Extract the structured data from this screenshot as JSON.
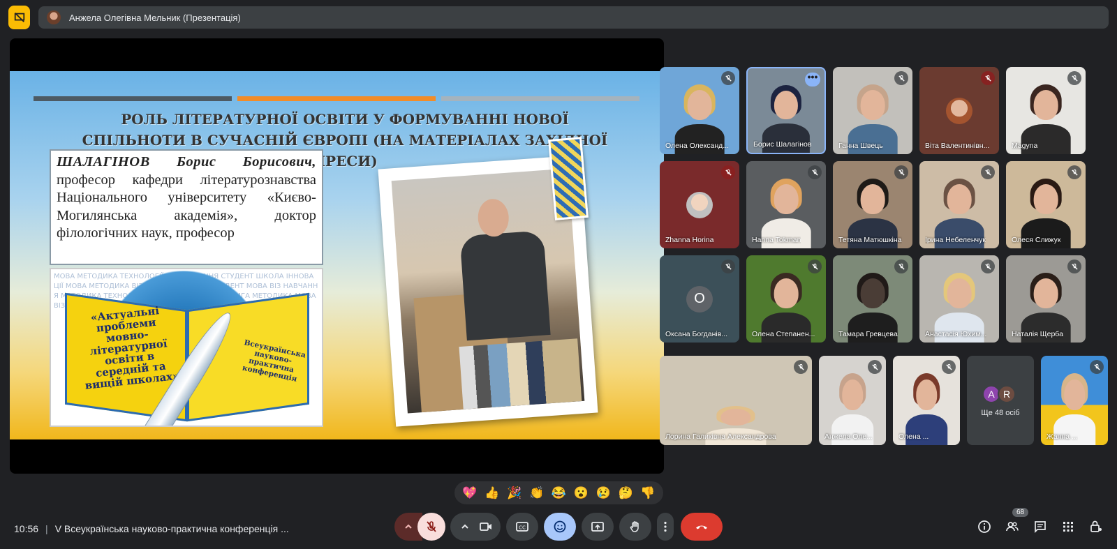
{
  "header": {
    "presenter_label": "Анжела Олегівна Мельник (Презентація)"
  },
  "slide": {
    "title": "РОЛЬ ЛІТЕРАТУРНОЇ ОСВІТИ У ФОРМУВАННІ НОВОЇ СПІЛЬНОТИ В СУЧАСНІЙ ЄВРОПІ (НА МАТЕРІАЛАХ ЗАХІДНОЇ ПРЕСИ)",
    "speaker_name": "ШАЛАГІНОВ Борис Борисович,",
    "speaker_bio": "професор кафедри літературознавства Національного університету «Києво-Могилянська академія», доктор філологічних наук, професор",
    "book_title": "«Актуальні проблеми мовно-літературної освіти в середній та вищій школах»",
    "book_subtitle": "Всеукраїнська науково-практична конференція",
    "wordcloud": "МОВА МЕТОДИКА ТЕХНОЛОГІЇ ВІЗ НАВЧАННЯ СТУДЕНТ ШКОЛА ІННОВАЦІЇ МОВА МЕТОДИКА ВІЗ ІННОВАЦІЇ КНИГА СТУДЕНТ МОВА ВІЗ НАВЧАННЯ МЕТОДИКА ТЕХНОЛОГІЇ ІННОВАЦІЇ МОВА ВІЗ КНИГА МЕТОДИКА МОВА ВІЗ"
  },
  "colors": {
    "bar_1": "#4d5a63",
    "bar_2": "#f28c28",
    "bar_3": "#a5b3bd",
    "accent_blue": "#8ab4f8",
    "hangup_red": "#dc3b2f",
    "presenting_yellow": "#fbbc04"
  },
  "participants": [
    {
      "name": "Олена Олександ...",
      "muted": true
    },
    {
      "name": "Борис Шалагінов",
      "muted": false,
      "more_options": true
    },
    {
      "name": "Ганна Швець",
      "muted": true
    },
    {
      "name": "Віта Валентинівн...",
      "muted": true
    },
    {
      "name": "Magyna",
      "muted": true
    },
    {
      "name": "Zhanna Horina",
      "muted": true
    },
    {
      "name": "Hanna Tokman",
      "muted": true
    },
    {
      "name": "Тетяна Матюшкіна",
      "muted": true
    },
    {
      "name": "Ірина Небеленчук",
      "muted": true
    },
    {
      "name": "Олеся Слижук",
      "muted": true
    },
    {
      "name": "Оксана Богданів...",
      "muted": true,
      "initial": "О"
    },
    {
      "name": "Олена Степанен...",
      "muted": true
    },
    {
      "name": "Тамара Гревцева",
      "muted": true
    },
    {
      "name": "Анастасія Юхим...",
      "muted": true
    },
    {
      "name": "Наталія Щерба",
      "muted": true
    },
    {
      "name": "Лорина Галиківна Александрова",
      "muted": true
    },
    {
      "name": "Анжела Оле...",
      "muted": true
    },
    {
      "name": "Олена ...",
      "muted": true
    },
    {
      "name": "Жанна ...",
      "muted": false
    }
  ],
  "others": {
    "initials": [
      "A",
      "R"
    ],
    "label": "Ще 48 осіб"
  },
  "reactions": [
    "💖",
    "👍",
    "🎉",
    "👏",
    "😂",
    "😮",
    "😢",
    "🤔",
    "👎"
  ],
  "footer": {
    "time": "10:56",
    "separator": "|",
    "meeting_title": "V Всеукраїнська науково-практична конференція ...",
    "people_count": "68"
  }
}
